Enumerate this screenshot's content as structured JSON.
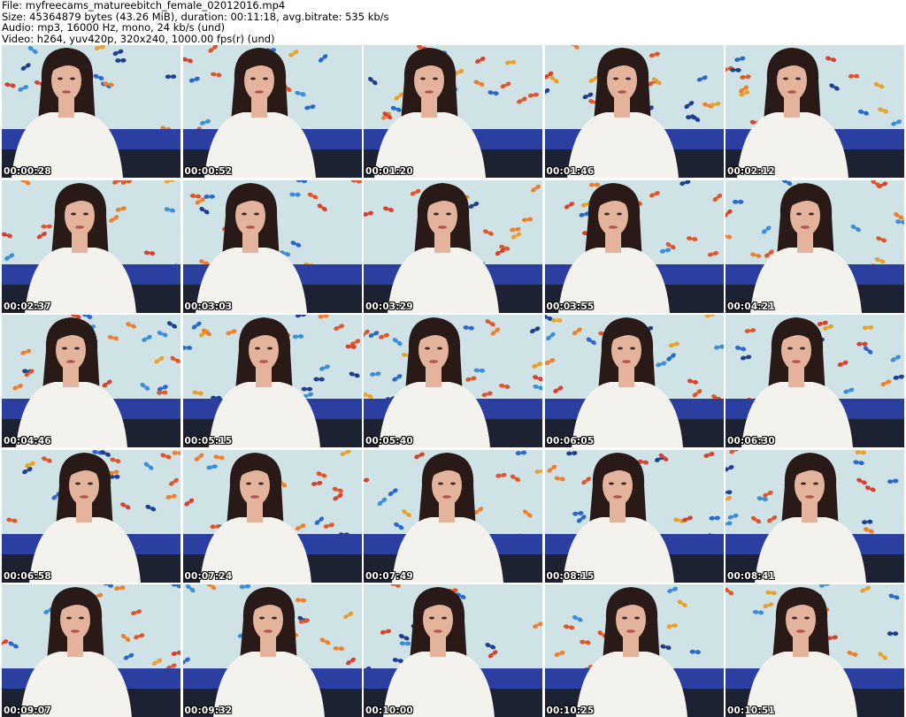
{
  "header": {
    "file_line": "File: myfreecams_matureebitch_female_02012016.mp4",
    "size_line": "Size: 45364879 bytes (43.26 MiB), duration: 00:11:18, avg.bitrate: 535 kb/s",
    "audio_line": "Audio: mp3, 16000 Hz, mono, 24 kb/s (und)",
    "video_line": "Video: h264, yuv420p, 320x240, 1000.00 fps(r) (und)"
  },
  "thumbnails": [
    {
      "time": "00:00:28"
    },
    {
      "time": "00:00:52"
    },
    {
      "time": "00:01:20"
    },
    {
      "time": "00:01:46"
    },
    {
      "time": "00:02:12"
    },
    {
      "time": "00:02:37"
    },
    {
      "time": "00:03:03"
    },
    {
      "time": "00:03:29"
    },
    {
      "time": "00:03:55"
    },
    {
      "time": "00:04:21"
    },
    {
      "time": "00:04:46"
    },
    {
      "time": "00:05:15"
    },
    {
      "time": "00:05:40"
    },
    {
      "time": "00:06:05"
    },
    {
      "time": "00:06:30"
    },
    {
      "time": "00:06:58"
    },
    {
      "time": "00:07:24"
    },
    {
      "time": "00:07:49"
    },
    {
      "time": "00:08:15"
    },
    {
      "time": "00:08:41"
    },
    {
      "time": "00:09:07"
    },
    {
      "time": "00:09:32"
    },
    {
      "time": "00:10:00"
    },
    {
      "time": "00:10:25"
    },
    {
      "time": "00:10:51"
    }
  ],
  "colors": {
    "wall": "#cfe2e6",
    "hair": "#2a1a17",
    "robe": "#f4f2ec",
    "skin": "#e3b39c",
    "pillow": "#2b3fa0"
  }
}
